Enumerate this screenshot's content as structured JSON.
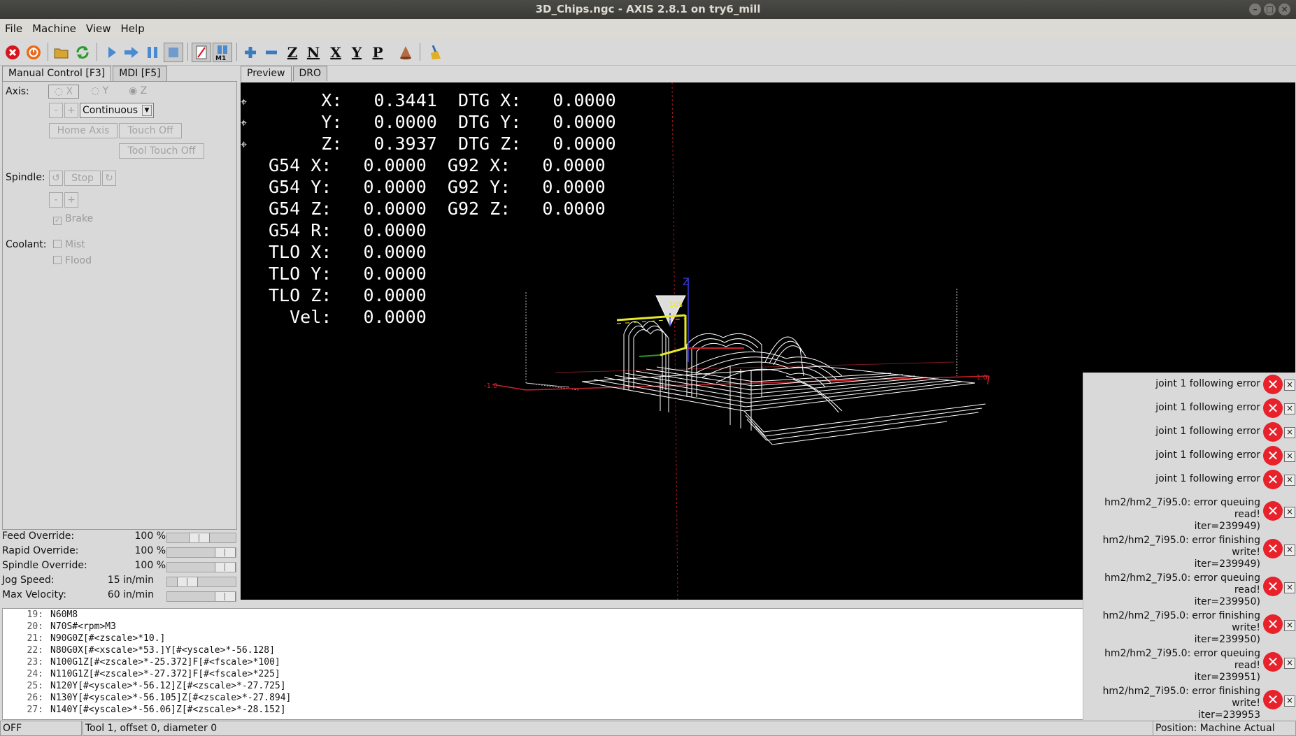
{
  "window": {
    "title": "3D_Chips.ngc - AXIS 2.8.1 on try6_mill"
  },
  "menu": [
    "File",
    "Machine",
    "View",
    "Help"
  ],
  "tabs_left": [
    "Manual Control [F3]",
    "MDI [F5]"
  ],
  "tabs_right": [
    "Preview",
    "DRO"
  ],
  "manual": {
    "axis_label": "Axis:",
    "axes": [
      "X",
      "Y",
      "Z"
    ],
    "minus": "-",
    "plus": "+",
    "jog_mode": "Continuous",
    "home_axis": "Home Axis",
    "touch_off": "Touch Off",
    "tool_touch_off": "Tool Touch Off",
    "spindle_label": "Spindle:",
    "stop": "Stop",
    "brake": "Brake",
    "coolant_label": "Coolant:",
    "mist": "Mist",
    "flood": "Flood"
  },
  "overrides": [
    {
      "name": "Feed Override:",
      "value": "100 %",
      "pos": 0.45
    },
    {
      "name": "Rapid Override:",
      "value": "100 %",
      "pos": 1.0
    },
    {
      "name": "Spindle Override:",
      "value": "100 %",
      "pos": 1.0
    },
    {
      "name": "Jog Speed:",
      "value": "15 in/min",
      "pos": 0.2
    },
    {
      "name": "Max Velocity:",
      "value": "60 in/min",
      "pos": 1.0
    }
  ],
  "dro": [
    {
      "l": "     X:",
      "v": "0.3441",
      "l2": "DTG X:",
      "v2": "0.0000"
    },
    {
      "l": "     Y:",
      "v": "0.0000",
      "l2": "DTG Y:",
      "v2": "0.0000"
    },
    {
      "l": "     Z:",
      "v": "0.3937",
      "l2": "DTG Z:",
      "v2": "0.0000"
    },
    {
      "l": "G54 X:",
      "v": "0.0000",
      "l2": "G92 X:",
      "v2": "0.0000"
    },
    {
      "l": "G54 Y:",
      "v": "0.0000",
      "l2": "G92 Y:",
      "v2": "0.0000"
    },
    {
      "l": "G54 Z:",
      "v": "0.0000",
      "l2": "G92 Z:",
      "v2": "0.0000"
    },
    {
      "l": "G54 R:",
      "v": "0.0000",
      "l2": "",
      "v2": ""
    },
    {
      "l": "TLO X:",
      "v": "0.0000",
      "l2": "",
      "v2": ""
    },
    {
      "l": "TLO Y:",
      "v": "0.0000",
      "l2": "",
      "v2": ""
    },
    {
      "l": "TLO Z:",
      "v": "0.0000",
      "l2": "",
      "v2": ""
    },
    {
      "l": "  Vel:",
      "v": "0.0000",
      "l2": "",
      "v2": ""
    }
  ],
  "gcode": [
    {
      "n": "19:",
      "t": "N60M8"
    },
    {
      "n": "20:",
      "t": "N70S#<rpm>M3"
    },
    {
      "n": "21:",
      "t": "N90G0Z[#<zscale>*10.]"
    },
    {
      "n": "22:",
      "t": "N80G0X[#<xscale>*53.]Y[#<yscale>*-56.128]"
    },
    {
      "n": "23:",
      "t": "N100G1Z[#<zscale>*-25.372]F[#<fscale>*100]"
    },
    {
      "n": "24:",
      "t": "N110G1Z[#<zscale>*-27.372]F[#<fscale>*225]"
    },
    {
      "n": "25:",
      "t": "N120Y[#<yscale>*-56.12]Z[#<zscale>*-27.725]"
    },
    {
      "n": "26:",
      "t": "N130Y[#<yscale>*-56.105]Z[#<zscale>*-27.894]"
    },
    {
      "n": "27:",
      "t": "N140Y[#<yscale>*-56.06]Z[#<zscale>*-28.152]"
    }
  ],
  "notifications": [
    {
      "text": "joint 1 following error"
    },
    {
      "text": "joint 1 following error"
    },
    {
      "text": "joint 1 following error"
    },
    {
      "text": "joint 1 following error"
    },
    {
      "text": "joint 1 following error"
    },
    {
      "text": "hm2/hm2_7i95.0: error queuing read!\niter=239949)"
    },
    {
      "text": "hm2/hm2_7i95.0: error finishing write!\niter=239949)"
    },
    {
      "text": "hm2/hm2_7i95.0: error queuing read!\niter=239950)"
    },
    {
      "text": "hm2/hm2_7i95.0: error finishing write!\niter=239950)"
    },
    {
      "text": "hm2/hm2_7i95.0: error queuing read!\niter=239951)"
    },
    {
      "text": "hm2/hm2_7i95.0: error finishing write!\niter=239953"
    }
  ],
  "status": {
    "state": "OFF",
    "tool": "Tool 1, offset 0, diameter 0",
    "position": "Position: Machine Actual"
  },
  "colors": {
    "estop": "#d8141c",
    "preview_bg": "#000000",
    "toolpath": "#ffffff",
    "axis_red": "#c8222a",
    "axis_yellow": "#e8e82a",
    "error_red": "#e8212a"
  }
}
